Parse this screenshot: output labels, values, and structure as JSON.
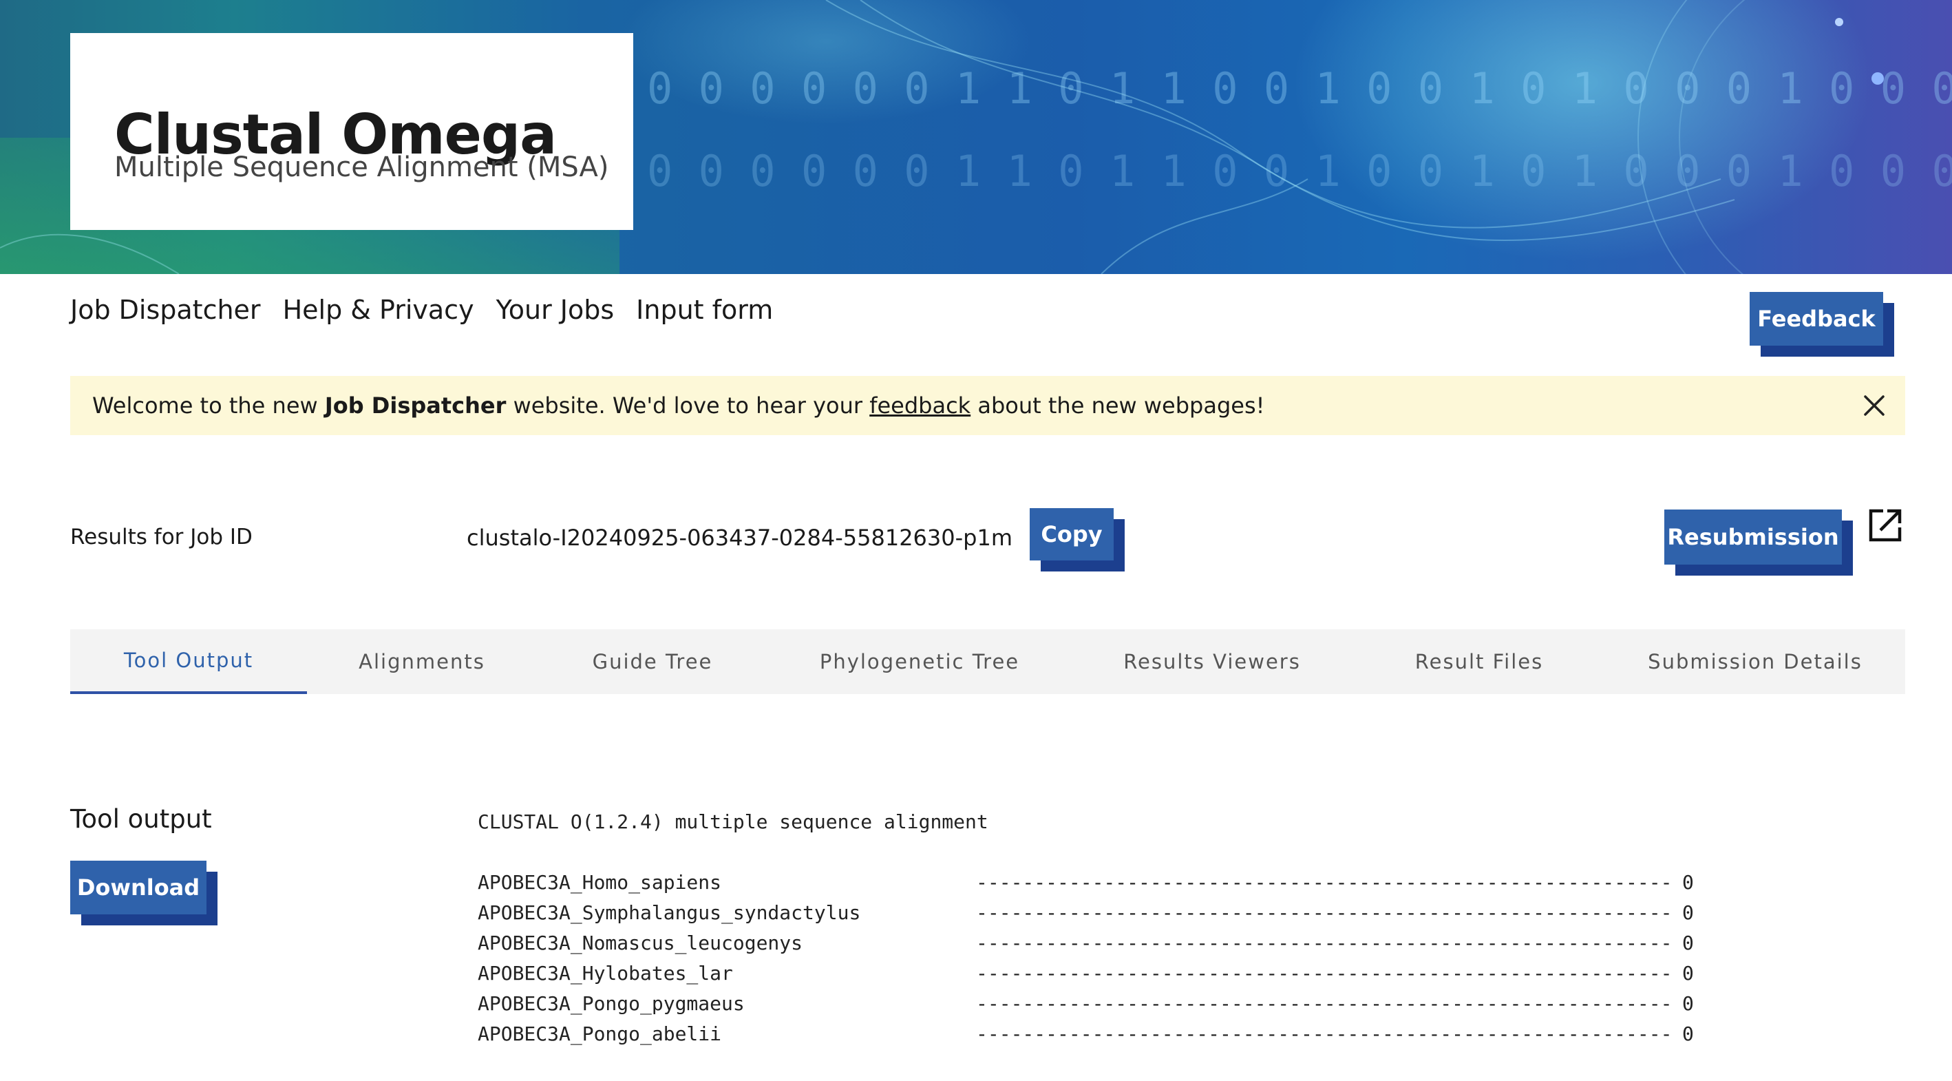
{
  "banner": {
    "title": "Clustal Omega",
    "subtitle": "Multiple Sequence Alignment (MSA)",
    "binary_digits": "0 0 0 0 0 0 1 1 0 1 1 0 0 1 0 0 1 0 1 0 0 0 1 0 0 0"
  },
  "nav": {
    "items": [
      "Job Dispatcher",
      "Help & Privacy",
      "Your Jobs",
      "Input form"
    ],
    "feedback_label": "Feedback"
  },
  "notice": {
    "prefix": "Welcome to the new ",
    "bold": "Job Dispatcher",
    "middle": " website. We'd love to hear your ",
    "link": "feedback",
    "suffix": " about the new webpages!"
  },
  "job": {
    "label": "Results for Job ID",
    "id": "clustalo-I20240925-063437-0284-55812630-p1m",
    "copy_label": "Copy",
    "resubmission_label": "Resubmission"
  },
  "tabs": [
    {
      "label": "Tool Output",
      "active": true
    },
    {
      "label": "Alignments",
      "active": false
    },
    {
      "label": "Guide Tree",
      "active": false
    },
    {
      "label": "Phylogenetic Tree",
      "active": false
    },
    {
      "label": "Results Viewers",
      "active": false
    },
    {
      "label": "Result Files",
      "active": false
    },
    {
      "label": "Submission Details",
      "active": false
    }
  ],
  "tool_output": {
    "title": "Tool output",
    "download_label": "Download",
    "header_line": "CLUSTAL O(1.2.4) multiple sequence alignment",
    "rows": [
      {
        "name": "APOBEC3A_Homo_sapiens",
        "seq": "------------------------------------------------------------",
        "count": "0"
      },
      {
        "name": "APOBEC3A_Symphalangus_syndactylus",
        "seq": "------------------------------------------------------------",
        "count": "0"
      },
      {
        "name": "APOBEC3A_Nomascus_leucogenys",
        "seq": "------------------------------------------------------------",
        "count": "0"
      },
      {
        "name": "APOBEC3A_Hylobates_lar",
        "seq": "------------------------------------------------------------",
        "count": "0"
      },
      {
        "name": "APOBEC3A_Pongo_pygmaeus",
        "seq": "------------------------------------------------------------",
        "count": "0"
      },
      {
        "name": "APOBEC3A_Pongo_abelii",
        "seq": "------------------------------------------------------------",
        "count": "0"
      }
    ]
  },
  "colors": {
    "accent": "#2f62ab",
    "accent_shadow": "#1c3f8e",
    "notice_bg": "#fdf8d8",
    "tab_bg": "#f3f3f3"
  },
  "icons": {
    "close": "close-icon",
    "external": "external-link-icon"
  }
}
